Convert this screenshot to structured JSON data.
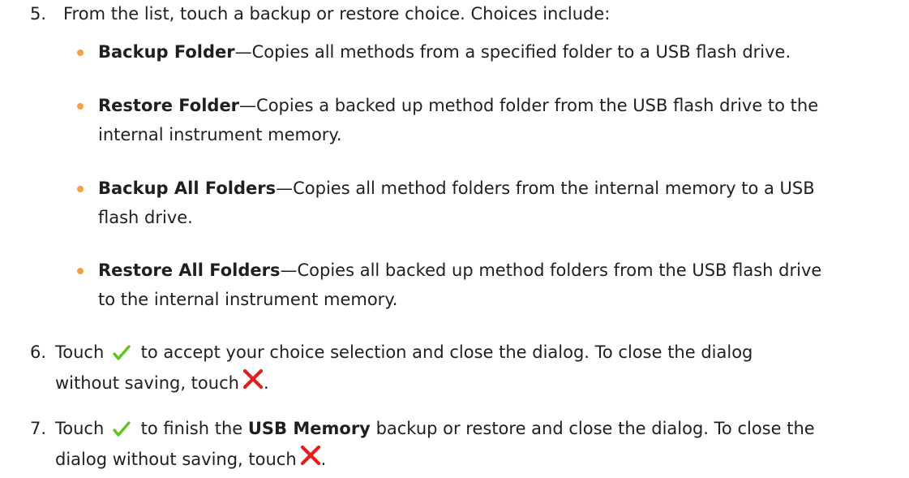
{
  "steps": [
    {
      "number": "5.",
      "intro": "From the list, touch a backup or restore choice. Choices include:"
    },
    {
      "number": "6.",
      "line1_a": "Touch",
      "line1_b": "to accept your choice selection and close the dialog. To close the dialog",
      "line2_a": "without saving, touch",
      "line2_b": "."
    },
    {
      "number": "7.",
      "line1_a": "Touch",
      "line1_b": "to finish the",
      "line1_term": "USB Memory",
      "line1_c": "backup or restore and close the dialog. To close the",
      "line2_a": "dialog without saving, touch",
      "line2_b": "."
    }
  ],
  "choices": [
    {
      "term": "Backup Folder",
      "lines": [
        "—Copies all methods from a specified folder to a USB flash drive."
      ]
    },
    {
      "term": "Restore Folder",
      "lines": [
        "—Copies a backed up method folder from the USB flash drive to the",
        "internal instrument memory."
      ]
    },
    {
      "term": "Backup All Folders",
      "lines": [
        "—Copies all method folders from the internal memory to a USB",
        "flash drive."
      ]
    },
    {
      "term": "Restore All Folders",
      "lines": [
        "—Copies all backed up method folders from the USB flash drive",
        "to the internal instrument memory."
      ]
    }
  ],
  "icons": {
    "accept": "checkmark-icon",
    "cancel": "x-icon"
  },
  "colors": {
    "bullet": "#f0a24a",
    "checkmark": "#5fc419",
    "x": "#e0201c"
  }
}
